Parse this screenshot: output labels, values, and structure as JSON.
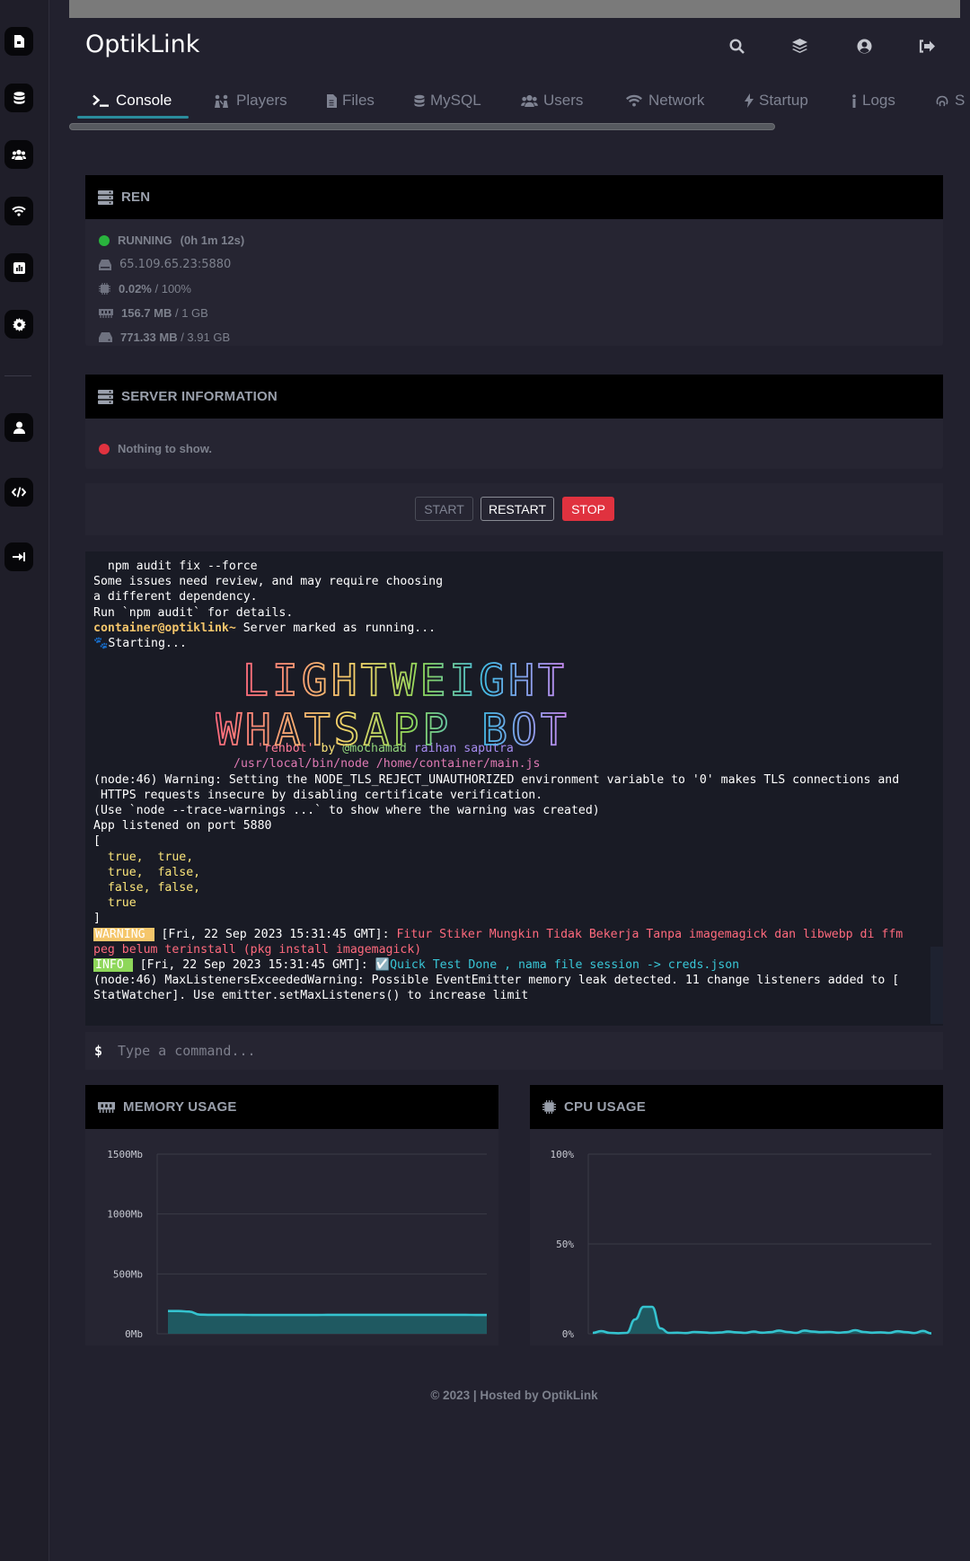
{
  "app": {
    "brand": "OptikLink"
  },
  "nav_rail": {
    "icons": [
      "file-icon",
      "database-icon",
      "users-icon",
      "wifi-icon",
      "stats-icon",
      "gear-icon",
      "user-icon",
      "code-icon",
      "logout-icon"
    ]
  },
  "header_icons": [
    "search-icon",
    "layers-icon",
    "account-icon",
    "sign-out-icon"
  ],
  "tabs": [
    {
      "label": "Console",
      "icon": "terminal-icon",
      "active": true
    },
    {
      "label": "Players",
      "icon": "players-icon"
    },
    {
      "label": "Files",
      "icon": "file-icon"
    },
    {
      "label": "MySQL",
      "icon": "database-icon"
    },
    {
      "label": "Users",
      "icon": "users-icon"
    },
    {
      "label": "Network",
      "icon": "wifi-icon"
    },
    {
      "label": "Startup",
      "icon": "bolt-icon"
    },
    {
      "label": "Logs",
      "icon": "info-icon"
    },
    {
      "label": "S",
      "icon": "fingerprint-icon"
    }
  ],
  "server_panel": {
    "title": "REN",
    "status": "RUNNING",
    "uptime": "(0h 1m 12s)",
    "address": "65.109.65.23:5880",
    "cpu_used": "0.02%",
    "cpu_limit": " / 100%",
    "memory_used": "156.7 MB",
    "memory_limit": " / 1 GB",
    "disk_used": "771.33 MB",
    "disk_limit": " / 3.91 GB",
    "status_color": "#29b33d"
  },
  "info_panel": {
    "title": "SERVER INFORMATION",
    "empty": "Nothing to show.",
    "status_color": "#e0323f"
  },
  "controls": {
    "start": "START",
    "restart": "RESTART",
    "stop": "STOP"
  },
  "console": {
    "lines": [
      "  npm audit fix --force",
      "Some issues need review, and may require choosing",
      "a different dependency.",
      "Run `npm audit` for details."
    ],
    "prompt_user": "container@optiklink~",
    "prompt_msg": " Server marked as running...",
    "starting": "🐾Starting...",
    "banner_line1": "LIGHTWEIGHT",
    "banner_line2": "WHATSAPP BOT",
    "credit_quote": "'renbot'",
    "credit_by": " by ",
    "credit_handle": "@mochamad",
    "credit_name": " raihan saputra",
    "exec_path": "/usr/local/bin/node /home/container/main.js",
    "warn_lines": [
      "(node:46) Warning: Setting the NODE_TLS_REJECT_UNAUTHORIZED environment variable to '0' makes TLS connections and",
      " HTTPS requests insecure by disabling certificate verification.",
      "(Use `node --trace-warnings ...` to show where the warning was created)",
      "App listened on port 5880",
      "["
    ],
    "bool_lines": [
      "  true,  true,",
      "  true,  false,",
      "  false, false,",
      "  true"
    ],
    "close_bracket": "]",
    "warning_badge": "WARNING ",
    "warning_time": " [Fri, 22 Sep 2023 15:31:45 GMT]: ",
    "warning_msg_1": "Fitur Stiker Mungkin Tidak Bekerja Tanpa imagemagick dan libwebp di ffm",
    "warning_msg_2": "peg belum terinstall (pkg install imagemagick)",
    "info_badge": "INFO ",
    "info_time": " [Fri, 22 Sep 2023 15:31:45 GMT]: ",
    "info_check": "☑️",
    "info_msg": "Quick Test Done , nama file session -> creds.json",
    "leak_lines": [
      "(node:46) MaxListenersExceededWarning: Possible EventEmitter memory leak detected. 11 change listeners added to [",
      "StatWatcher]. Use emitter.setMaxListeners() to increase limit"
    ]
  },
  "command": {
    "prompt": "$",
    "placeholder": "Type a command..."
  },
  "memory_chart": {
    "title": "MEMORY USAGE"
  },
  "cpu_chart": {
    "title": "CPU USAGE"
  },
  "chart_data": [
    {
      "type": "area",
      "title": "MEMORY USAGE",
      "y_ticks": [
        "1500Mb",
        "1000Mb",
        "500Mb",
        "0Mb"
      ],
      "ylim": [
        0,
        1500
      ],
      "values": [
        190,
        190,
        185,
        160,
        158,
        158,
        158,
        158,
        157,
        157,
        157,
        157,
        157,
        157,
        157,
        158,
        158,
        158,
        158,
        158,
        158,
        158,
        158,
        158,
        158,
        158,
        158,
        158,
        158,
        157,
        157
      ],
      "color": "#35c3cf"
    },
    {
      "type": "area",
      "title": "CPU USAGE",
      "y_ticks": [
        "100%",
        "50%",
        "0%"
      ],
      "ylim": [
        0,
        100
      ],
      "values": [
        0.5,
        1.5,
        0.5,
        0.3,
        0.5,
        8,
        15,
        15,
        3,
        0.5,
        0.6,
        0.4,
        1,
        0.8,
        0.5,
        0.7,
        1.2,
        0.8,
        0.5,
        1.2,
        0.6,
        0.9,
        1.8,
        1,
        0.5,
        1.8,
        1.2,
        0.9,
        1,
        0.6,
        0.9,
        2,
        1,
        0.6,
        0.8,
        0.5,
        1.4,
        0.9,
        0.4,
        1.6,
        0.2
      ],
      "color": "#35c3cf"
    }
  ],
  "footer": "© 2023 | Hosted by OptikLink"
}
